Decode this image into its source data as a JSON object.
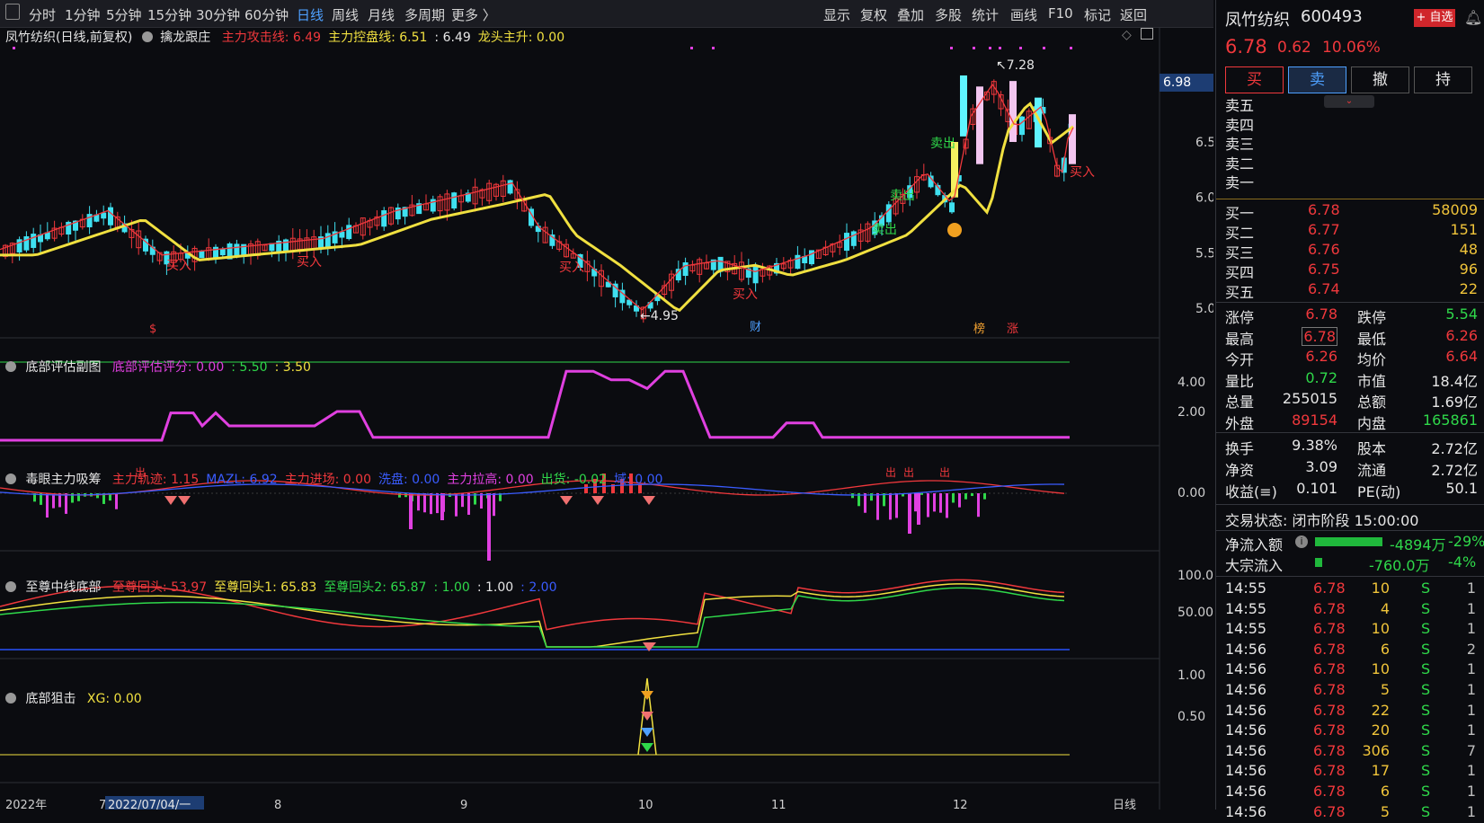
{
  "toolbar_left": [
    {
      "label": "分时",
      "active": false
    },
    {
      "label": "1分钟",
      "active": false
    },
    {
      "label": "5分钟",
      "active": false
    },
    {
      "label": "15分钟",
      "active": false
    },
    {
      "label": "30分钟",
      "active": false
    },
    {
      "label": "60分钟",
      "active": false
    },
    {
      "label": "日线",
      "active": true
    },
    {
      "label": "周线",
      "active": false
    },
    {
      "label": "月线",
      "active": false
    },
    {
      "label": "多周期",
      "active": false
    },
    {
      "label": "更多 〉",
      "active": false
    }
  ],
  "toolbar_right": [
    "显示",
    "复权",
    "叠加",
    "多股",
    "统计",
    "画线",
    "F10",
    "标记",
    "返回"
  ],
  "main_panel": {
    "title": "凤竹纺织(日线,前复权)",
    "indicator_name": "擒龙跟庄",
    "values": [
      {
        "text": "主力攻击线: 6.49",
        "color": "#f0383c"
      },
      {
        "text": "主力控盘线: 6.51",
        "color": "#f0e040"
      },
      {
        "text": ": 6.49",
        "color": "#e6e6e6"
      },
      {
        "text": "龙头主升: 0.00",
        "color": "#f0e040"
      }
    ],
    "price_axis": [
      "6.50",
      "6.00",
      "5.50",
      "5.00"
    ],
    "current_price_tag": "6.98",
    "high_label": "7.28",
    "low_label": "4.95",
    "signals": [
      {
        "text": "买入",
        "color": "#f0383c"
      },
      {
        "text": "买入",
        "color": "#f0383c"
      },
      {
        "text": "买入",
        "color": "#f0383c"
      },
      {
        "text": "买入",
        "color": "#f0383c"
      },
      {
        "text": "卖出",
        "color": "#2fd84a"
      },
      {
        "text": "卖出",
        "color": "#2fd84a"
      },
      {
        "text": "卖出",
        "color": "#2fd84a"
      },
      {
        "text": "买入",
        "color": "#f0383c"
      }
    ],
    "event_tags": [
      {
        "text": "$",
        "color": "#f0383c"
      },
      {
        "text": "财",
        "color": "#4ea0ff"
      },
      {
        "text": "榜",
        "color": "#f0a030"
      },
      {
        "text": "涨",
        "color": "#f0383c"
      }
    ]
  },
  "sub1": {
    "name": "底部评估副图",
    "values": [
      {
        "text": "底部评估评分: 0.00",
        "color": "#e040e0"
      },
      {
        "text": ": 5.50",
        "color": "#2fd84a"
      },
      {
        "text": ": 3.50",
        "color": "#f0e040"
      }
    ],
    "axis": [
      "4.00",
      "2.00"
    ]
  },
  "sub2": {
    "name": "毒眼主力吸筹",
    "values": [
      {
        "text": "主力轨迹: 1.15",
        "color": "#f0383c"
      },
      {
        "text": "MAZL: 6.92",
        "color": "#3a5cff"
      },
      {
        "text": "主力进场: 0.00",
        "color": "#f0383c"
      },
      {
        "text": "洗盘: 0.00",
        "color": "#3a5cff"
      },
      {
        "text": "主力拉高: 0.00",
        "color": "#e040e0"
      },
      {
        "text": "出货: -0.02",
        "color": "#2fd84a"
      },
      {
        "text": "域: 0.00",
        "color": "#3a5cff"
      }
    ],
    "axis": [
      "0.00"
    ],
    "tags": [
      "出",
      "出",
      "出",
      "出"
    ]
  },
  "sub3": {
    "name": "至尊中线底部",
    "values": [
      {
        "text": "至尊回头: 53.97",
        "color": "#f0383c"
      },
      {
        "text": "至尊回头1: 65.83",
        "color": "#f0e040"
      },
      {
        "text": "至尊回头2: 65.87",
        "color": "#2fd84a"
      },
      {
        "text": ": 1.00",
        "color": "#2fd84a"
      },
      {
        "text": ": 1.00",
        "color": "#e6e6e6"
      },
      {
        "text": ": 2.00",
        "color": "#3a5cff"
      }
    ],
    "axis": [
      "100.0",
      "50.00"
    ]
  },
  "sub4": {
    "name": "底部狙击",
    "values": [
      {
        "text": "XG: 0.00",
        "color": "#f0e040"
      }
    ],
    "axis": [
      "1.00",
      "0.50"
    ]
  },
  "date_axis": {
    "labels": [
      "2022年",
      "7",
      "8",
      "9",
      "10",
      "11",
      "12"
    ],
    "cursor_date": "2022/07/04/一",
    "period": "日线"
  },
  "quote": {
    "name": "凤竹纺织",
    "code": "600493",
    "watch_button": "+ 自选",
    "price": "6.78",
    "change": "0.62",
    "change_pct": "10.06%",
    "buttons": [
      "买",
      "卖",
      "撤",
      "持"
    ],
    "asks": [
      {
        "label": "卖五",
        "price": "",
        "vol": ""
      },
      {
        "label": "卖四",
        "price": "",
        "vol": ""
      },
      {
        "label": "卖三",
        "price": "",
        "vol": ""
      },
      {
        "label": "卖二",
        "price": "",
        "vol": ""
      },
      {
        "label": "卖一",
        "price": "",
        "vol": ""
      }
    ],
    "bids": [
      {
        "label": "买一",
        "price": "6.78",
        "vol": "58009"
      },
      {
        "label": "买二",
        "price": "6.77",
        "vol": "151"
      },
      {
        "label": "买三",
        "price": "6.76",
        "vol": "48"
      },
      {
        "label": "买四",
        "price": "6.75",
        "vol": "96"
      },
      {
        "label": "买五",
        "price": "6.74",
        "vol": "22"
      }
    ],
    "stats": [
      {
        "l1": "涨停",
        "v1": "6.78",
        "c1": "red",
        "l2": "跌停",
        "v2": "5.54",
        "c2": "green"
      },
      {
        "l1": "最高",
        "v1": "6.78",
        "c1": "red",
        "l2": "最低",
        "v2": "6.26",
        "c2": "red"
      },
      {
        "l1": "今开",
        "v1": "6.26",
        "c1": "red",
        "l2": "均价",
        "v2": "6.64",
        "c2": "red"
      },
      {
        "l1": "量比",
        "v1": "0.72",
        "c1": "green",
        "l2": "市值",
        "v2": "18.4亿",
        "c2": "white"
      },
      {
        "l1": "总量",
        "v1": "255015",
        "c1": "white",
        "l2": "总额",
        "v2": "1.69亿",
        "c2": "white"
      },
      {
        "l1": "外盘",
        "v1": "89154",
        "c1": "red",
        "l2": "内盘",
        "v2": "165861",
        "c2": "green"
      }
    ],
    "stats2": [
      {
        "l1": "换手",
        "v1": "9.38%",
        "l2": "股本",
        "v2": "2.72亿"
      },
      {
        "l1": "净资",
        "v1": "3.09",
        "l2": "流通",
        "v2": "2.72亿"
      },
      {
        "l1": "收益(≡)",
        "v1": "0.101",
        "l2": "PE(动)",
        "v2": "50.1"
      }
    ],
    "trade_status": "交易状态: 闭市阶段 15:00:00",
    "net_inflow_label": "净流入额",
    "net_inflow_value": "-4894万",
    "net_inflow_pct": "-29%",
    "block_inflow_label": "大宗流入",
    "block_inflow_value": "-760.0万",
    "block_inflow_pct": "-4%",
    "ticks": [
      {
        "time": "14:55",
        "price": "6.78",
        "vol": "10",
        "side": "S",
        "n": "1"
      },
      {
        "time": "14:55",
        "price": "6.78",
        "vol": "4",
        "side": "S",
        "n": "1"
      },
      {
        "time": "14:55",
        "price": "6.78",
        "vol": "10",
        "side": "S",
        "n": "1"
      },
      {
        "time": "14:56",
        "price": "6.78",
        "vol": "6",
        "side": "S",
        "n": "2"
      },
      {
        "time": "14:56",
        "price": "6.78",
        "vol": "10",
        "side": "S",
        "n": "1"
      },
      {
        "time": "14:56",
        "price": "6.78",
        "vol": "5",
        "side": "S",
        "n": "1"
      },
      {
        "time": "14:56",
        "price": "6.78",
        "vol": "22",
        "side": "S",
        "n": "1"
      },
      {
        "time": "14:56",
        "price": "6.78",
        "vol": "20",
        "side": "S",
        "n": "1"
      },
      {
        "time": "14:56",
        "price": "6.78",
        "vol": "306",
        "side": "S",
        "n": "7"
      },
      {
        "time": "14:56",
        "price": "6.78",
        "vol": "17",
        "side": "S",
        "n": "1"
      },
      {
        "time": "14:56",
        "price": "6.78",
        "vol": "6",
        "side": "S",
        "n": "1"
      },
      {
        "time": "14:56",
        "price": "6.78",
        "vol": "5",
        "side": "S",
        "n": "1"
      }
    ]
  }
}
